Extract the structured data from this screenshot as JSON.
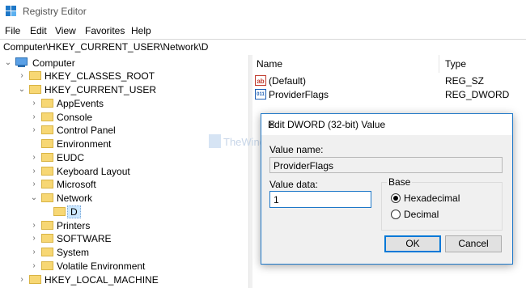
{
  "window": {
    "title": "Registry Editor"
  },
  "menu": [
    "File",
    "Edit",
    "View",
    "Favorites",
    "Help"
  ],
  "address": "Computer\\HKEY_CURRENT_USER\\Network\\D",
  "tree": {
    "root": "Computer",
    "hives": {
      "classes_root": "HKEY_CLASSES_ROOT",
      "current_user": "HKEY_CURRENT_USER",
      "local_machine": "HKEY_LOCAL_MACHINE"
    },
    "current_user_children": [
      "AppEvents",
      "Console",
      "Control Panel",
      "Environment",
      "EUDC",
      "Keyboard Layout",
      "Microsoft",
      "Network",
      "D",
      "Printers",
      "SOFTWARE",
      "System",
      "Volatile Environment"
    ]
  },
  "values_pane": {
    "headers": {
      "name": "Name",
      "type": "Type"
    },
    "rows": [
      {
        "name": "(Default)",
        "type": "REG_SZ",
        "icon": "string-value-icon"
      },
      {
        "name": "ProviderFlags",
        "type": "REG_DWORD",
        "icon": "binary-value-icon"
      }
    ]
  },
  "watermark": "TheWindowsClub",
  "dialog": {
    "title": "Edit DWORD (32-bit) Value",
    "value_name_label": "Value name:",
    "value_name": "ProviderFlags",
    "value_data_label": "Value data:",
    "value_data": "1",
    "base_label": "Base",
    "hex_label": "Hexadecimal",
    "dec_label": "Decimal",
    "ok": "OK",
    "cancel": "Cancel"
  },
  "colors": {
    "accent": "#0078d7",
    "folder": "#f7d774",
    "selection": "#cce8ff"
  }
}
